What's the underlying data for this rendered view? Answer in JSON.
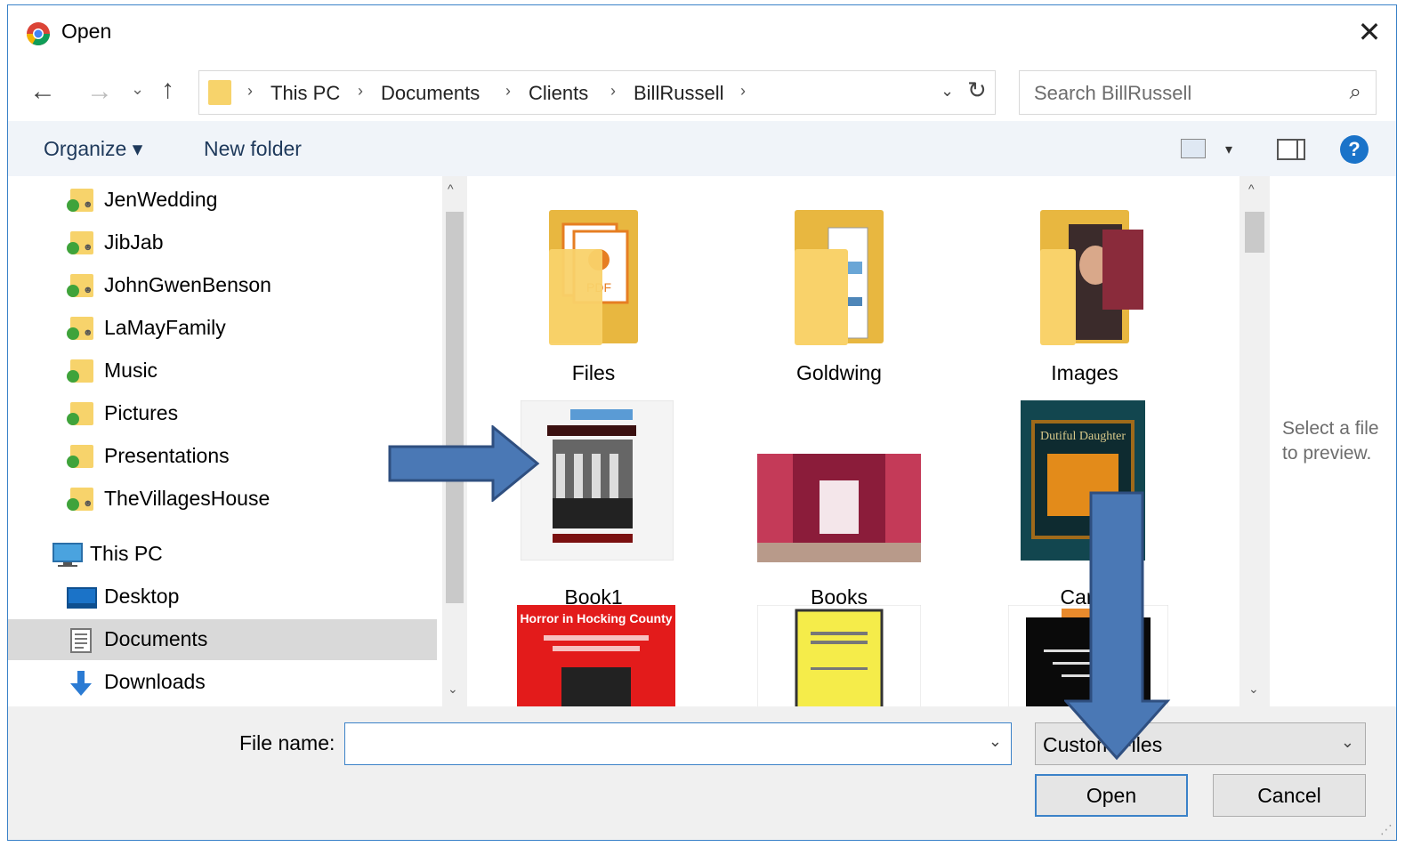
{
  "window": {
    "title": "Open",
    "close_symbol": "✕"
  },
  "nav": {
    "back_symbol": "←",
    "forward_symbol": "→",
    "recent_symbol": "⌄",
    "up_symbol": "↑",
    "refresh_symbol": "↻",
    "address_dropdown_symbol": "⌄",
    "breadcrumbs": [
      "This PC",
      "Documents",
      "Clients",
      "BillRussell"
    ],
    "separator": "›"
  },
  "search": {
    "placeholder": "Search BillRussell",
    "icon_symbol": "⌕"
  },
  "toolbar": {
    "organize_label": "Organize ▾",
    "new_folder_label": "New folder",
    "view_dropdown_symbol": "▾",
    "help_symbol": "?"
  },
  "sidebar": {
    "items": [
      {
        "label": "JenWedding",
        "icon": "shared-folder-icon"
      },
      {
        "label": "JibJab",
        "icon": "shared-folder-icon"
      },
      {
        "label": "JohnGwenBenson",
        "icon": "shared-folder-icon"
      },
      {
        "label": "LaMayFamily",
        "icon": "shared-folder-icon"
      },
      {
        "label": "Music",
        "icon": "synced-folder-icon"
      },
      {
        "label": "Pictures",
        "icon": "synced-folder-icon"
      },
      {
        "label": "Presentations",
        "icon": "synced-folder-icon"
      },
      {
        "label": "TheVillagesHouse",
        "icon": "shared-folder-icon"
      },
      {
        "label": "This PC",
        "icon": "computer-icon"
      },
      {
        "label": "Desktop",
        "icon": "desktop-icon"
      },
      {
        "label": "Documents",
        "icon": "documents-icon",
        "selected": true
      },
      {
        "label": "Downloads",
        "icon": "download-icon"
      }
    ],
    "scroll_up_symbol": "^",
    "scroll_down_symbol": "⌄"
  },
  "files": {
    "items": [
      {
        "name": "Files",
        "kind": "folder"
      },
      {
        "name": "Goldwing",
        "kind": "folder"
      },
      {
        "name": "Images",
        "kind": "folder"
      },
      {
        "name": "Book1",
        "kind": "image"
      },
      {
        "name": "Books",
        "kind": "image"
      },
      {
        "name": "Cana",
        "kind": "image"
      },
      {
        "name": "",
        "kind": "image"
      },
      {
        "name": "",
        "kind": "image"
      },
      {
        "name": "",
        "kind": "image"
      }
    ],
    "thumb_text": {
      "horror_title": "Horror in Hocking County",
      "dutiful": "Dutiful Daughter",
      "pdf": "PDF"
    }
  },
  "preview": {
    "empty_text": "Select a file to preview."
  },
  "footer": {
    "file_name_label": "File name:",
    "file_name_value": "",
    "file_type": "Custom Files",
    "open_label": "Open",
    "cancel_label": "Cancel",
    "dropdown_symbol": "⌄"
  },
  "colors": {
    "accent": "#3b82c8",
    "folder": "#f9d26a",
    "arrow_fill": "#4a78b5",
    "arrow_stroke": "#2f4f80"
  }
}
